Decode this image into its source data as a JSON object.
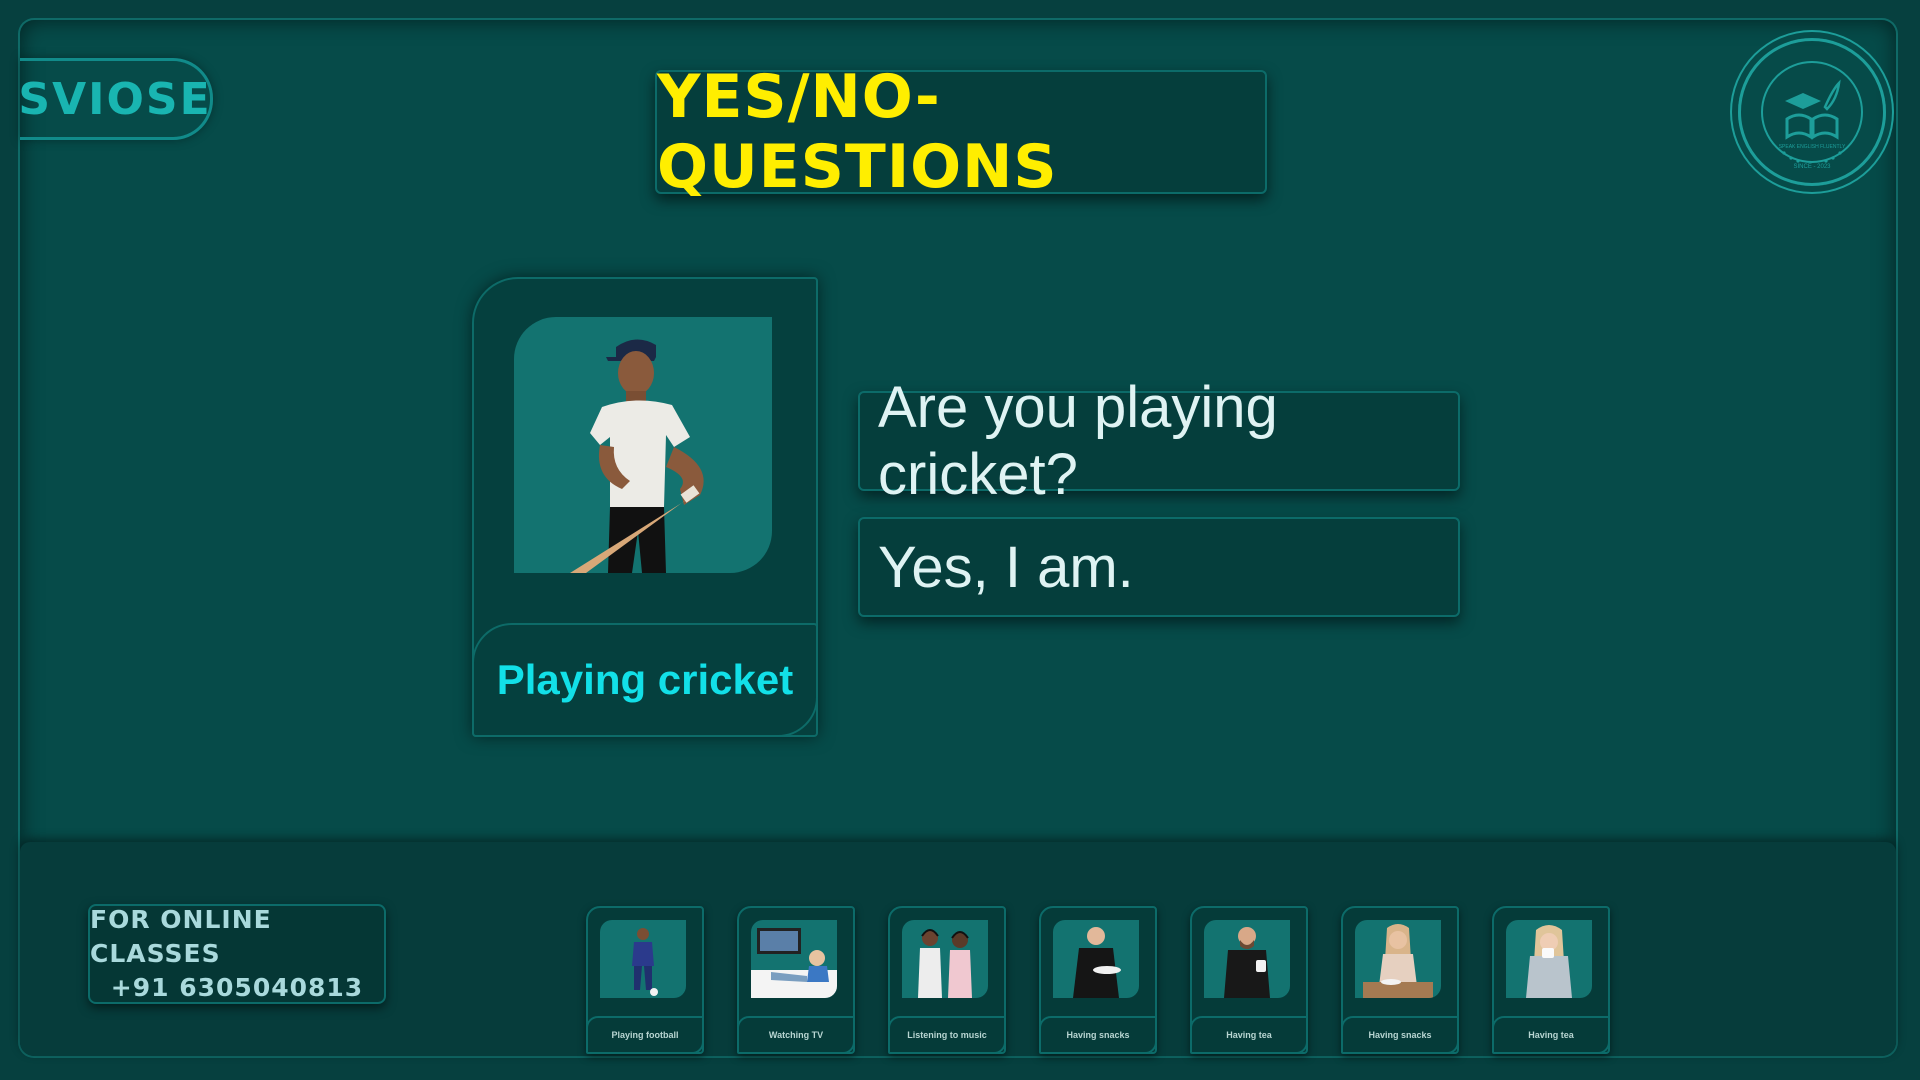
{
  "brand": {
    "logo_text": "SVIOSE",
    "badge_text": "SRI VENKATESWARA ONLINE SPOKEN ENGLISH SCHOOL",
    "badge_tagline": "SPEAK ENGLISH FLUENTLY",
    "badge_since": "SINCE - 2023"
  },
  "header": {
    "title": "YES/NO-QUESTIONS"
  },
  "main_card": {
    "label": "Playing cricket",
    "icon": "cricket-player-photo"
  },
  "dialogue": {
    "question": "Are you playing cricket?",
    "answer": "Yes, I am."
  },
  "footer": {
    "contact_line1": "FOR ONLINE CLASSES",
    "contact_line2": "+91 6305040813",
    "thumbnails": [
      {
        "label": "Playing football",
        "icon": "football-player-photo"
      },
      {
        "label": "Watching TV",
        "icon": "watching-tv-photo"
      },
      {
        "label": "Listening to music",
        "icon": "listening-music-photo"
      },
      {
        "label": "Having snacks",
        "icon": "snacks-photo"
      },
      {
        "label": "Having tea",
        "icon": "tea-photo"
      },
      {
        "label": "Having snacks",
        "icon": "snacks-photo"
      },
      {
        "label": "Having tea",
        "icon": "tea-photo"
      }
    ]
  },
  "colors": {
    "background": "#064b49",
    "title_text": "#ffee00",
    "label_text": "#12e0e8",
    "accent": "#19b5b1"
  }
}
